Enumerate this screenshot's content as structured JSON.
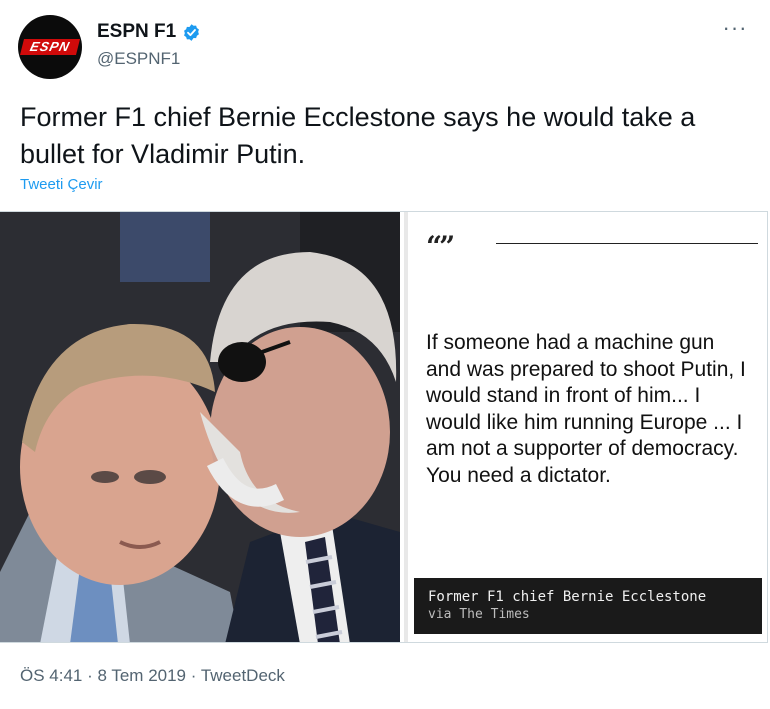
{
  "author": {
    "display_name": "ESPN F1",
    "handle": "@ESPNF1",
    "logo_text": "ESPN",
    "verified": true
  },
  "tweet": {
    "text": "Former F1 chief Bernie Ecclestone says he would take a bullet for Vladimir Putin.",
    "translate_label": "Tweeti Çevir"
  },
  "media": {
    "quote_mark": "“”",
    "quote": "If someone had a machine gun and was prepared to shoot Putin, I would stand in front of him... I would like him running Europe ... I am not a supporter of democracy. You need a dictator.",
    "attribution_name": "Former F1 chief Bernie Ecclestone",
    "attribution_source": "via The Times"
  },
  "meta": {
    "time": "ÖS 4:41",
    "date": "8 Tem 2019",
    "source": "TweetDeck",
    "separator": " · "
  },
  "icons": {
    "more": "more-icon",
    "verified": "verified-badge-icon"
  },
  "colors": {
    "accent": "#1d9bf0",
    "secondary_text": "#536471",
    "logo_red": "#d00a0a"
  }
}
